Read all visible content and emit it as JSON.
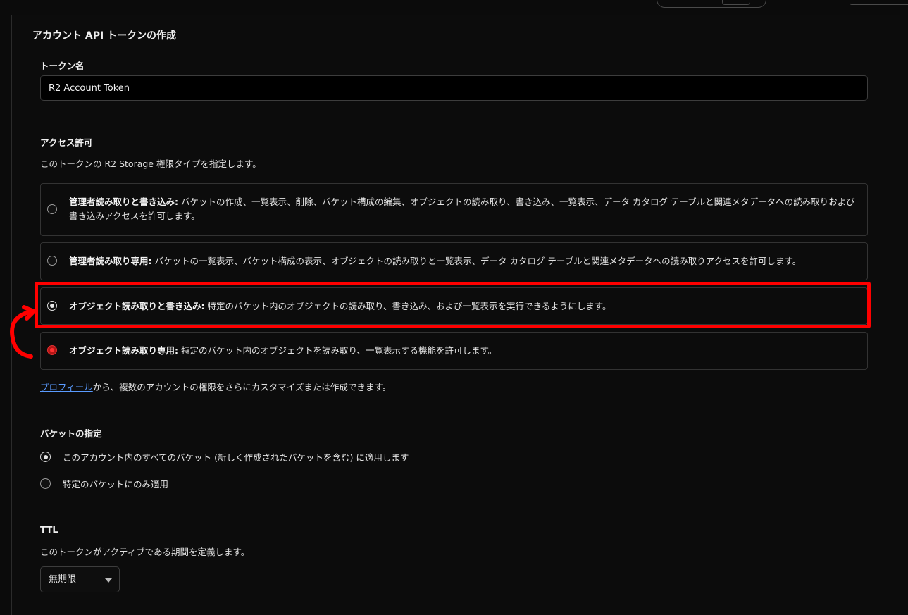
{
  "form": {
    "title": "アカウント API トークンの作成",
    "token_name": {
      "label": "トークン名",
      "value": "R2 Account Token"
    },
    "permissions": {
      "label": "アクセス許可",
      "description": "このトークンの R2 Storage 権限タイプを指定します。",
      "options": [
        {
          "name": "管理者読み取りと書き込み:",
          "desc": " バケットの作成、一覧表示、削除、バケット構成の編集、オブジェクトの読み取り、書き込み、一覧表示、データ カタログ テーブルと関連メタデータへの読み取りおよび書き込みアクセスを許可します。",
          "state": "unchecked"
        },
        {
          "name": "管理者読み取り専用:",
          "desc": " バケットの一覧表示、バケット構成の表示、オブジェクトの読み取りと一覧表示、データ カタログ テーブルと関連メタデータへの読み取りアクセスを許可します。",
          "state": "unchecked"
        },
        {
          "name": "オブジェクト読み取りと書き込み:",
          "desc": " 特定のバケット内のオブジェクトの読み取り、書き込み、および一覧表示を実行できるようにします。",
          "state": "checked"
        },
        {
          "name": "オブジェクト読み取り専用:",
          "desc": " 特定のバケット内のオブジェクトを読み取り、一覧表示する機能を許可します。",
          "state": "checked-red"
        }
      ],
      "profile_link": "プロフィール",
      "profile_suffix": "から、複数のアカウントの権限をさらにカスタマイズまたは作成できます。"
    },
    "bucket": {
      "label": "バケットの指定",
      "options": [
        {
          "label": "このアカウント内のすべてのバケット (新しく作成されたバケットを含む) に適用します",
          "checked": true
        },
        {
          "label": "特定のバケットにのみ適用",
          "checked": false
        }
      ]
    },
    "ttl": {
      "label": "TTL",
      "description": "このトークンがアクティブである期間を定義します。",
      "selected": "無期限"
    }
  },
  "colors": {
    "background": "#0b0b0b",
    "highlight": "#ff0000",
    "link": "#5a9bff"
  }
}
